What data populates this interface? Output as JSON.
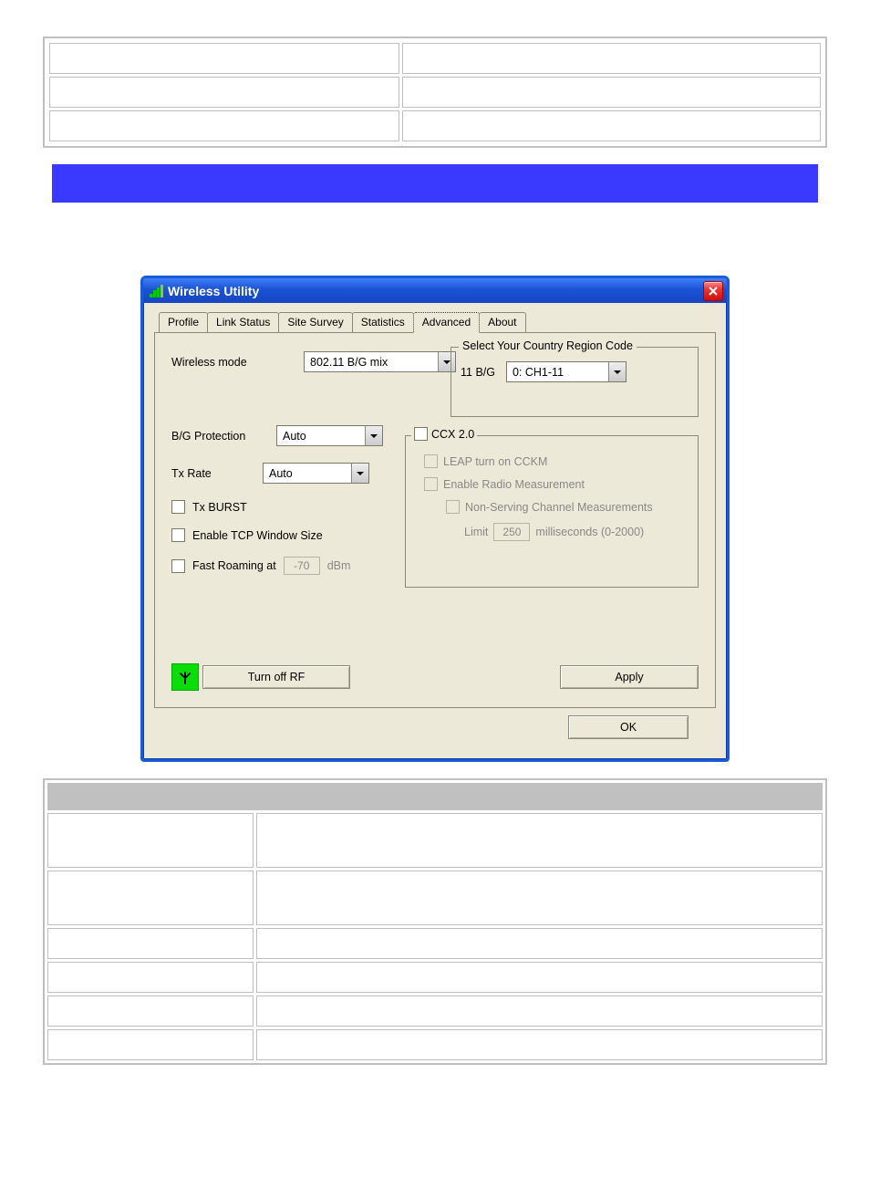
{
  "window": {
    "title": "Wireless Utility"
  },
  "tabs": {
    "items": [
      {
        "label": "Profile"
      },
      {
        "label": "Link Status"
      },
      {
        "label": "Site Survey"
      },
      {
        "label": "Statistics"
      },
      {
        "label": "Advanced"
      },
      {
        "label": "About"
      }
    ],
    "active_index": 4
  },
  "advanced": {
    "wireless_mode_label": "Wireless mode",
    "wireless_mode_value": "802.11 B/G mix",
    "country_group_title": "Select Your Country Region Code",
    "country_band_label": "11 B/G",
    "country_value": "0: CH1-11",
    "bg_protection_label": "B/G Protection",
    "bg_protection_value": "Auto",
    "tx_rate_label": "Tx Rate",
    "tx_rate_value": "Auto",
    "tx_burst_label": "Tx BURST",
    "tcp_window_label": "Enable TCP Window Size",
    "fast_roaming_label": "Fast Roaming at",
    "fast_roaming_value": "-70",
    "fast_roaming_unit": "dBm",
    "ccx": {
      "title": "CCX 2.0",
      "leap_label": "LEAP turn on CCKM",
      "radio_meas_label": "Enable Radio Measurement",
      "non_serving_label": "Non-Serving Channel Measurements",
      "limit_label": "Limit",
      "limit_value": "250",
      "limit_suffix": "milliseconds (0-2000)"
    },
    "turnoff_rf_label": "Turn off RF",
    "apply_label": "Apply",
    "ok_label": "OK"
  }
}
